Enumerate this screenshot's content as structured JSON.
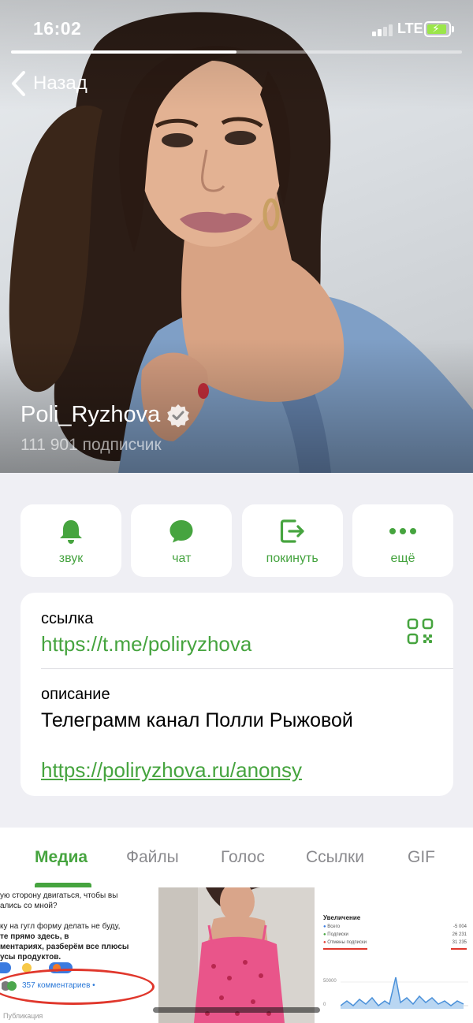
{
  "status_bar": {
    "time": "16:02",
    "network": "LTE",
    "battery_level": 0.8
  },
  "story_progress": 0.5,
  "nav": {
    "back_label": "Назад"
  },
  "profile": {
    "name": "Poli_Ryzhova",
    "subscribers": "111 901 подписчик",
    "verified": true
  },
  "actions": [
    {
      "label": "звук",
      "icon": "bell-icon"
    },
    {
      "label": "чат",
      "icon": "chat-bubble-icon"
    },
    {
      "label": "покинуть",
      "icon": "leave-icon"
    },
    {
      "label": "ещё",
      "icon": "more-dots-icon"
    }
  ],
  "info": {
    "link_label": "ссылка",
    "link_value": "https://t.me/poliryzhova",
    "description_label": "описание",
    "description_text": "Телеграмм канал Полли Рыжовой",
    "description_url": "https://poliryzhova.ru/anonsy"
  },
  "tabs": [
    {
      "label": "Медиа",
      "active": true
    },
    {
      "label": "Файлы",
      "active": false
    },
    {
      "label": "Голос",
      "active": false
    },
    {
      "label": "Ссылки",
      "active": false
    },
    {
      "label": "GIF",
      "active": false
    }
  ],
  "media": {
    "thumb1": {
      "lines": [
        "ую сторону двигаться, чтобы вы",
        "ались со мной?",
        "",
        "ку на гугл форму делать не буду,",
        "те прямо здесь, в",
        "ментариях, разберём все плюсы",
        "усы продуктов."
      ],
      "comments": "357 комментариев •",
      "publication": "Публикация"
    },
    "thumb3": {
      "title": "Увеличение",
      "rows": [
        {
          "label": "Всего",
          "value": "-5 004"
        },
        {
          "label": "Подписки",
          "value": "26 231"
        },
        {
          "label": "Отмены подписки",
          "value": "31 235"
        }
      ],
      "y_ticks": [
        "50000",
        "0"
      ]
    }
  },
  "colors": {
    "accent": "#46a43f",
    "background": "#efeff4",
    "alert": "#e0372c"
  }
}
